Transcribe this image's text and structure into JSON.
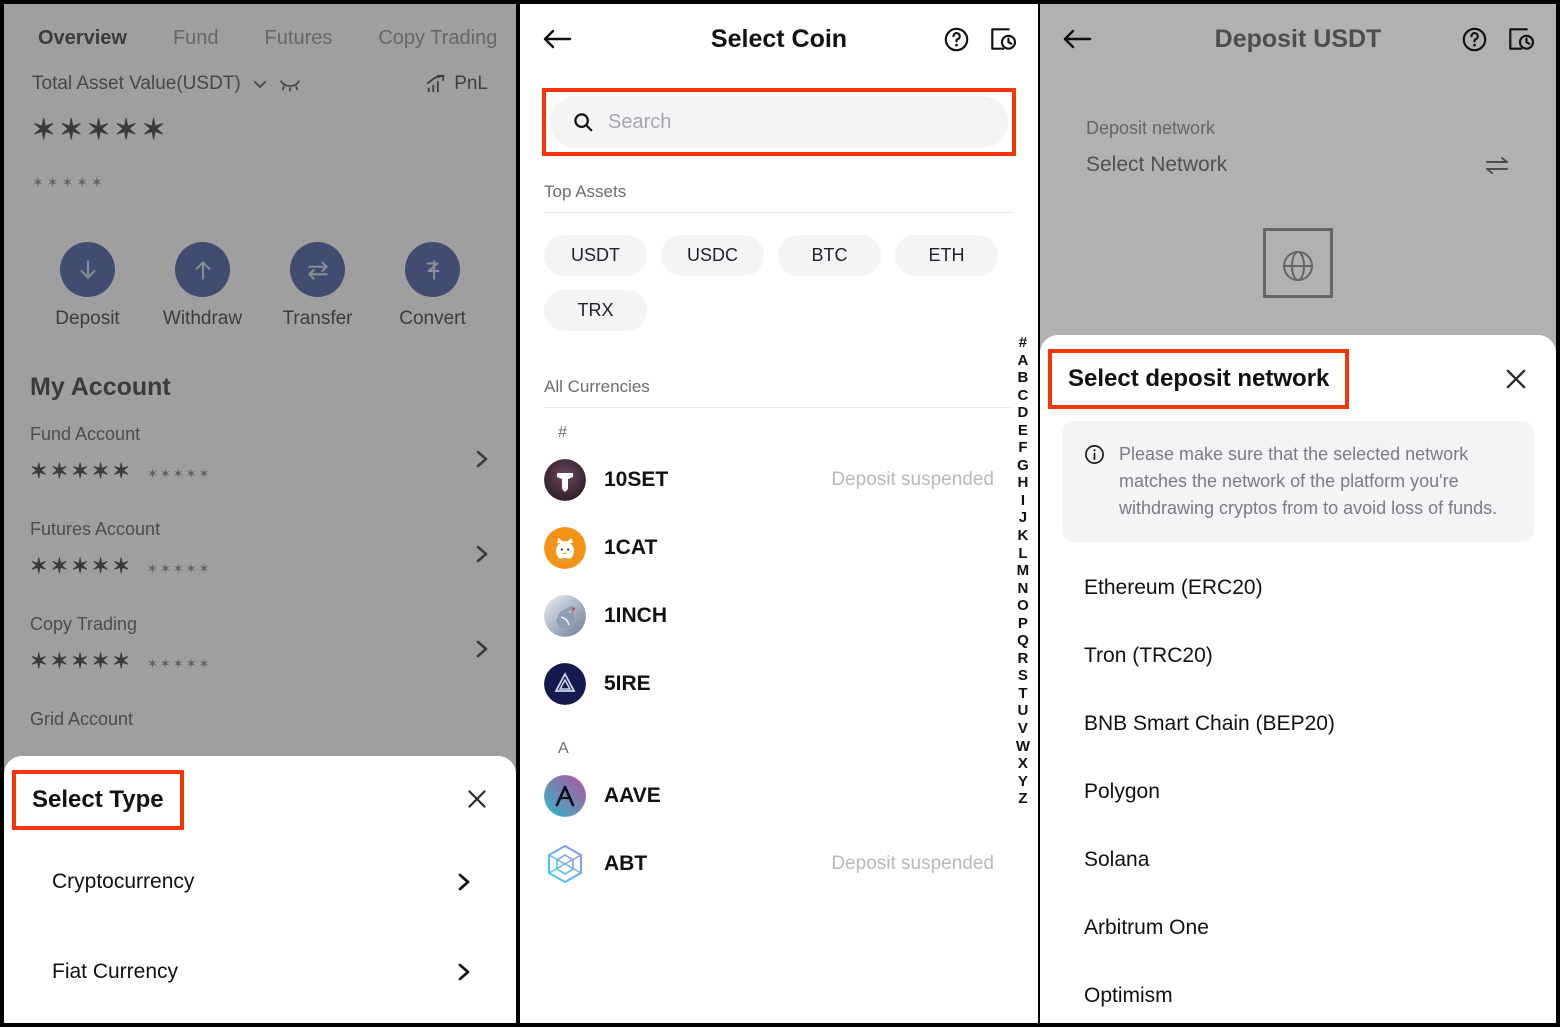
{
  "left_panel": {
    "tabs": [
      {
        "label": "Overview",
        "active": true
      },
      {
        "label": "Fund",
        "active": false
      },
      {
        "label": "Futures",
        "active": false
      },
      {
        "label": "Copy Trading",
        "active": false
      }
    ],
    "total_asset": {
      "label": "Total Asset Value(USDT)",
      "chevron_icon": "chevron-down-icon",
      "hide_icon": "eye-off-icon",
      "pnl_label": "PnL",
      "pnl_icon": "chart-up-icon",
      "value_masked": "✶✶✶✶✶",
      "secondary_masked": "✶✶✶✶✶"
    },
    "actions": [
      {
        "label": "Deposit",
        "icon": "arrow-down-icon"
      },
      {
        "label": "Withdraw",
        "icon": "arrow-up-icon"
      },
      {
        "label": "Transfer",
        "icon": "transfer-arrows-icon"
      },
      {
        "label": "Convert",
        "icon": "convert-icon"
      }
    ],
    "accounts_title": "My Account",
    "accounts": [
      {
        "name": "Fund Account",
        "value_masked": "✶✶✶✶✶",
        "sub_masked": "✶✶✶✶✶"
      },
      {
        "name": "Futures Account",
        "value_masked": "✶✶✶✶✶",
        "sub_masked": "✶✶✶✶✶"
      },
      {
        "name": "Copy Trading",
        "value_masked": "✶✶✶✶✶",
        "sub_masked": "✶✶✶✶✶"
      },
      {
        "name": "Grid Account",
        "value_masked": "✶✶✶✶✶",
        "sub_masked": "✶✶✶✶✶"
      }
    ],
    "select_type_sheet": {
      "title": "Select Type",
      "close_icon": "close-icon",
      "options": [
        {
          "label": "Cryptocurrency",
          "chevron_icon": "chevron-right-icon"
        },
        {
          "label": "Fiat Currency",
          "chevron_icon": "chevron-right-icon"
        }
      ]
    }
  },
  "mid_panel": {
    "header": {
      "title": "Select Coin",
      "back_icon": "arrow-left-icon",
      "help_icon": "help-circle-icon",
      "history_icon": "transaction-history-icon"
    },
    "search": {
      "placeholder": "Search",
      "value": "",
      "icon": "search-icon"
    },
    "top_assets_title": "Top Assets",
    "top_assets": [
      "USDT",
      "USDC",
      "BTC",
      "ETH",
      "TRX"
    ],
    "all_currencies_title": "All Currencies",
    "groups": [
      {
        "letter": "#",
        "coins": [
          {
            "symbol": "10SET",
            "status": "Deposit suspended",
            "icon_colors": [
              "#3a2230",
              "#6b4a5e"
            ]
          },
          {
            "symbol": "1CAT",
            "status": "",
            "icon_colors": [
              "#f59218",
              "#f07c05"
            ]
          },
          {
            "symbol": "1INCH",
            "status": "",
            "icon_colors": [
              "#9fb3c8",
              "#4a5a72"
            ]
          },
          {
            "symbol": "5IRE",
            "status": "",
            "icon_colors": [
              "#141a4d",
              "#0d1238"
            ]
          }
        ]
      },
      {
        "letter": "A",
        "coins": [
          {
            "symbol": "AAVE",
            "status": "",
            "icon_colors": [
              "#2ebac6",
              "#b6509e"
            ]
          },
          {
            "symbol": "ABT",
            "status": "Deposit suspended",
            "icon_colors": [
              "#37d3f0",
              "#9a8cf5"
            ]
          }
        ]
      }
    ],
    "alpha_index": [
      "#",
      "A",
      "B",
      "C",
      "D",
      "E",
      "F",
      "G",
      "H",
      "I",
      "J",
      "K",
      "L",
      "M",
      "N",
      "O",
      "P",
      "Q",
      "R",
      "S",
      "T",
      "U",
      "V",
      "W",
      "X",
      "Y",
      "Z"
    ]
  },
  "right_panel": {
    "header": {
      "title": "Deposit USDT",
      "back_icon": "arrow-left-icon",
      "help_icon": "help-circle-icon",
      "history_icon": "transaction-history-icon"
    },
    "deposit_network_card": {
      "label": "Deposit network",
      "value": "Select Network",
      "swap_icon": "swap-arrows-icon",
      "qr_placeholder_icon": "globe-qr-placeholder-icon"
    },
    "network_sheet": {
      "title": "Select deposit network",
      "close_icon": "close-icon",
      "notice_icon": "info-circle-icon",
      "notice": "Please make sure that the selected network matches the network of the platform you're withdrawing cryptos from to avoid loss of funds.",
      "networks": [
        "Ethereum (ERC20)",
        "Tron (TRC20)",
        "BNB Smart Chain (BEP20)",
        "Polygon",
        "Solana",
        "Arbitrum One",
        "Optimism"
      ]
    }
  },
  "theme": {
    "accent_blue": "#1e3a8f",
    "highlight_red": "#f4360a",
    "chip_gray": "#f3f4f6",
    "muted_text": "#b7b9bd"
  }
}
